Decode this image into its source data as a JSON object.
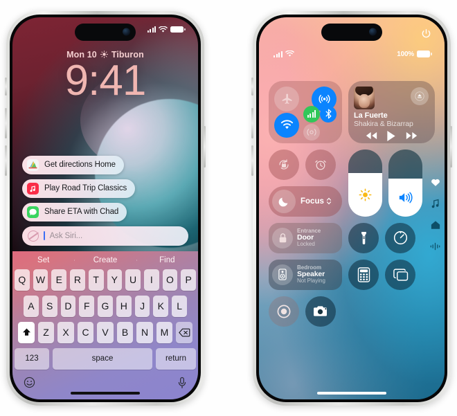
{
  "background_color": "#ffffff",
  "devices": [
    {
      "name": "iphone-lockscreen-siri",
      "frame_color": "#d8d9d6",
      "status_bar": {
        "signal": "cellular-bars",
        "wifi": "wifi-icon",
        "battery": "battery-icon"
      },
      "lock_screen": {
        "date": "Mon 10",
        "weather_icon": "sun-icon",
        "location": "Tiburon",
        "time": "9:41",
        "time_color": "#f0b6b1",
        "date_color": "#f5cfd0"
      },
      "siri_suggestions": [
        {
          "icon": "maps-app-icon",
          "label": "Get directions Home"
        },
        {
          "icon": "music-app-icon",
          "label": "Play Road Trip Classics"
        },
        {
          "icon": "messages-app-icon",
          "label": "Share ETA with Chad"
        }
      ],
      "ask_siri": {
        "icon": "siri-orb-icon",
        "placeholder": "Ask Siri...",
        "value": ""
      },
      "keyboard": {
        "suggestions": [
          "Set",
          "Create",
          "Find"
        ],
        "row1": [
          "Q",
          "W",
          "E",
          "R",
          "T",
          "Y",
          "U",
          "I",
          "O",
          "P"
        ],
        "row2": [
          "A",
          "S",
          "D",
          "F",
          "G",
          "H",
          "J",
          "K",
          "L"
        ],
        "row3": [
          "Z",
          "X",
          "C",
          "V",
          "B",
          "N",
          "M"
        ],
        "shift_icon": "shift-up-icon",
        "backspace_icon": "backspace-icon",
        "numbers_label": "123",
        "space_label": "space",
        "return_label": "return",
        "emoji_icon": "emoji-smiley-icon",
        "dictation_icon": "microphone-icon"
      }
    },
    {
      "name": "iphone-control-center",
      "frame_color": "#d8d9d6",
      "status_bar": {
        "signal": "cellular-bars",
        "wifi": "wifi-icon",
        "battery_percent": "100%",
        "battery": "battery-icon",
        "power_icon": "power-button-icon"
      },
      "connectivity": {
        "label": "connectivity-module",
        "airplane_mode": {
          "icon": "airplane-icon",
          "state": "off"
        },
        "airdrop": {
          "icon": "airdrop-icon",
          "state": "on",
          "color": "#0b84ff"
        },
        "wifi": {
          "icon": "wifi-icon",
          "state": "on",
          "color": "#0b84ff"
        },
        "cellular": {
          "icon": "cellular-bars-icon",
          "state": "on",
          "color": "#32c759"
        },
        "bluetooth": {
          "icon": "bluetooth-icon",
          "state": "on",
          "color": "#0b84ff"
        },
        "hotspot": {
          "icon": "personal-hotspot-icon",
          "state": "off"
        }
      },
      "now_playing": {
        "artwork": "album-artwork",
        "title": "La Fuerte",
        "artist": "Shakira & Bizarrap",
        "airplay_icon": "airplay-icon",
        "rewind_icon": "rewind-icon",
        "play_icon": "play-icon",
        "forward_icon": "fast-forward-icon"
      },
      "toggles": {
        "orientation_lock": {
          "icon": "rotation-lock-icon",
          "state": "off"
        },
        "alarm": {
          "icon": "alarm-clock-icon",
          "state": "off"
        }
      },
      "focus": {
        "icon": "moon-icon",
        "label": "Focus",
        "chevron": "chevron-updown-icon"
      },
      "sliders": {
        "brightness": {
          "icon": "sun-icon",
          "value": 64
        },
        "volume": {
          "icon": "speaker-wave-icon",
          "value": 56
        }
      },
      "home_tiles": [
        {
          "icon": "lock-icon",
          "room": "Entrance",
          "name": "Door",
          "state": "Locked"
        },
        {
          "icon": "speaker-box-icon",
          "room": "Bedroom",
          "name": "Speaker",
          "state": "Not Playing"
        }
      ],
      "utilities": [
        {
          "icon": "flashlight-icon",
          "name": "flashlight"
        },
        {
          "icon": "timer-icon",
          "name": "timer"
        },
        {
          "icon": "calculator-icon",
          "name": "calculator"
        },
        {
          "icon": "screen-mirroring-icon",
          "name": "screen-mirroring"
        },
        {
          "icon": "screen-record-icon",
          "name": "screen-record"
        },
        {
          "icon": "camera-icon",
          "name": "camera"
        }
      ],
      "page_strip": [
        {
          "icon": "heart-icon",
          "name": "health-page"
        },
        {
          "icon": "music-note-icon",
          "name": "music-page"
        },
        {
          "icon": "home-house-icon",
          "name": "home-page"
        },
        {
          "icon": "connectivity-page-icon",
          "name": "connectivity-page"
        }
      ]
    }
  ]
}
